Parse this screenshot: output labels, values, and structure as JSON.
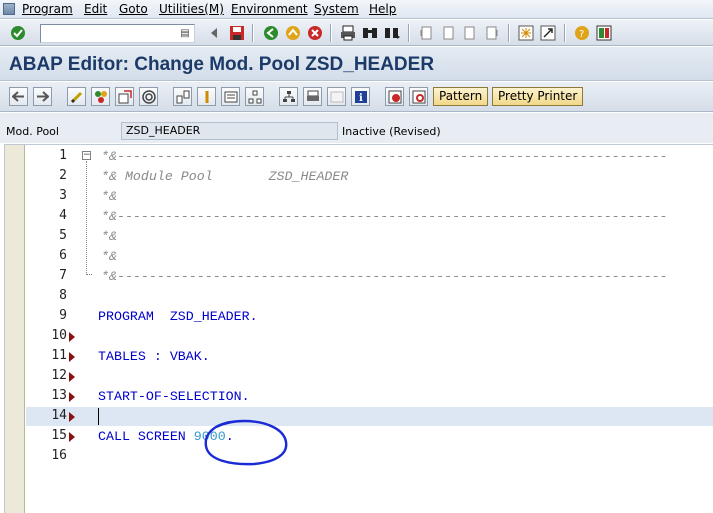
{
  "menu": {
    "items": [
      "Program",
      "Edit",
      "Goto",
      "Utilities(M)",
      "Environment",
      "System",
      "Help"
    ]
  },
  "toolbar": {
    "command_value": "",
    "icons": [
      "enter-icon",
      "back-icon",
      "save-icon",
      "exit-icon",
      "cancel-icon",
      "print-icon",
      "find-icon",
      "find-next-icon",
      "first-page-icon",
      "previous-page-icon",
      "next-page-icon",
      "last-page-icon",
      "create-session-icon",
      "shortcut-icon",
      "help-icon",
      "layout-icon"
    ]
  },
  "title": "ABAP Editor: Change Mod. Pool ZSD_HEADER",
  "app_toolbar": {
    "pattern_label": "Pattern",
    "pretty_printer_label": "Pretty Printer"
  },
  "header": {
    "label": "Mod. Pool",
    "value": "ZSD_HEADER",
    "status": "Inactive (Revised)"
  },
  "editor": {
    "lines": [
      {
        "no": "1",
        "text": "*&---------------------------------------------------------------------",
        "type": "comment",
        "marker": false
      },
      {
        "no": "2",
        "text": "*& Module Pool       ZSD_HEADER",
        "type": "comment",
        "marker": false
      },
      {
        "no": "3",
        "text": "*&",
        "type": "comment",
        "marker": false
      },
      {
        "no": "4",
        "text": "*&---------------------------------------------------------------------",
        "type": "comment",
        "marker": false
      },
      {
        "no": "5",
        "text": "*&",
        "type": "comment",
        "marker": false
      },
      {
        "no": "6",
        "text": "*&",
        "type": "comment",
        "marker": false
      },
      {
        "no": "7",
        "text": "*&---------------------------------------------------------------------",
        "type": "comment",
        "marker": false
      },
      {
        "no": "8",
        "text": "",
        "type": "code",
        "marker": false
      },
      {
        "no": "9",
        "text": "PROGRAM  ZSD_HEADER.",
        "type": "code",
        "marker": false
      },
      {
        "no": "10",
        "text": "",
        "type": "code",
        "marker": true
      },
      {
        "no": "11",
        "text": "TABLES : VBAK.",
        "type": "code",
        "marker": true
      },
      {
        "no": "12",
        "text": "",
        "type": "code",
        "marker": true
      },
      {
        "no": "13",
        "text": "START-OF-SELECTION.",
        "type": "code",
        "marker": true
      },
      {
        "no": "14",
        "text": "",
        "type": "code",
        "marker": true
      },
      {
        "no": "15",
        "text": "CALL SCREEN 9000.",
        "type": "code",
        "marker": true
      },
      {
        "no": "16",
        "text": "",
        "type": "code",
        "marker": false
      }
    ],
    "call_screen_keyword": "CALL SCREEN ",
    "call_screen_number": "9000",
    "call_screen_period": "."
  },
  "colors": {
    "keyword": "#0000cc",
    "comment": "#8a8a8a",
    "number": "#3399cc",
    "annotation_ink": "#1a2bd6",
    "title": "#1b3a68"
  }
}
